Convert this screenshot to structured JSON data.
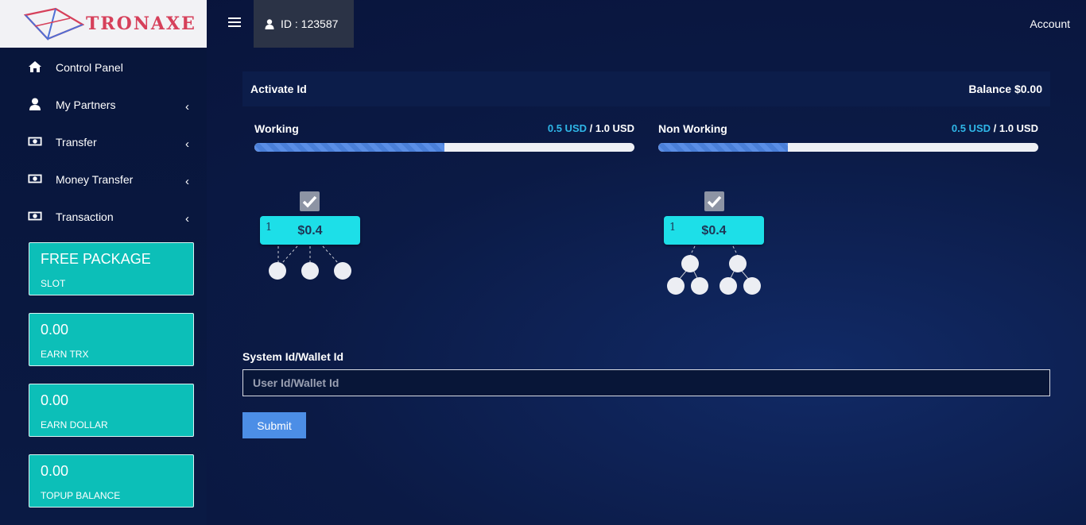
{
  "brand": {
    "name": "TRONAXE"
  },
  "topbar": {
    "id_text": "ID : 123587",
    "account_label": "Account"
  },
  "sidebar": {
    "items": [
      {
        "label": "Control Panel",
        "icon": "home-icon",
        "has_submenu": false
      },
      {
        "label": "My Partners",
        "icon": "user-icon",
        "has_submenu": true
      },
      {
        "label": "Transfer",
        "icon": "money-icon",
        "has_submenu": true
      },
      {
        "label": "Money Transfer",
        "icon": "money-icon",
        "has_submenu": true
      },
      {
        "label": "Transaction",
        "icon": "money-icon",
        "has_submenu": true
      }
    ],
    "cards": [
      {
        "value": "FREE PACKAGE",
        "label": "SLOT"
      },
      {
        "value": "0.00",
        "label": "EARN TRX"
      },
      {
        "value": "0.00",
        "label": "EARN DOLLAR"
      },
      {
        "value": "0.00",
        "label": "TOPUP BALANCE"
      }
    ]
  },
  "main": {
    "title": "Activate Id",
    "balance": "Balance $0.00",
    "working": {
      "label": "Working",
      "current": "0.5 USD",
      "separator": " / ",
      "total": "1.0 USD",
      "progress": 0.5,
      "node": {
        "number": "1",
        "amount": "$0.4"
      }
    },
    "non_working": {
      "label": "Non Working",
      "current": "0.5 USD",
      "separator": " / ",
      "total": "1.0 USD",
      "progress": 0.34,
      "node": {
        "number": "1",
        "amount": "$0.4"
      }
    },
    "form": {
      "label": "System Id/Wallet Id",
      "placeholder": "User Id/Wallet Id",
      "value": "",
      "submit_label": "Submit"
    }
  },
  "colors": {
    "accent": "#0cbfb8",
    "node": "#1ddfe8",
    "highlight": "#2fb7e8",
    "button": "#4c8ee6"
  }
}
